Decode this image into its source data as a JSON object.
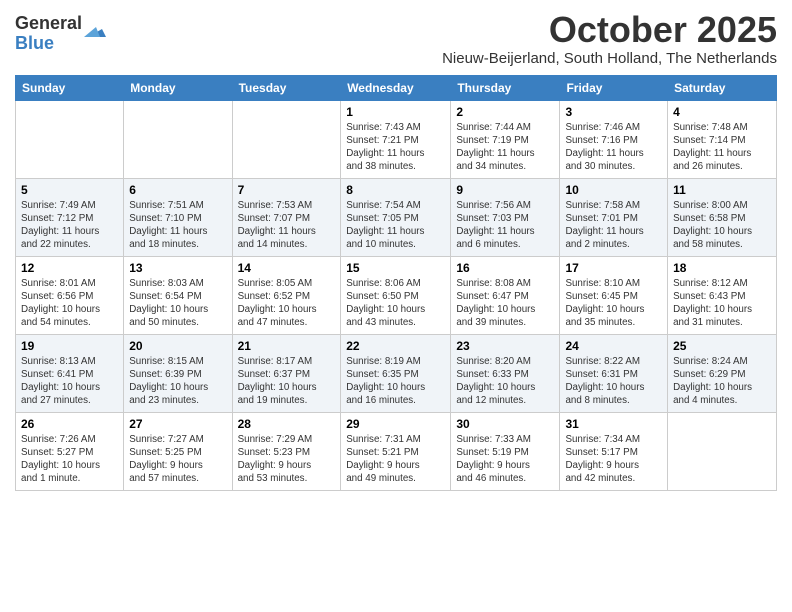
{
  "logo": {
    "general": "General",
    "blue": "Blue"
  },
  "header": {
    "month": "October 2025",
    "location": "Nieuw-Beijerland, South Holland, The Netherlands"
  },
  "days_of_week": [
    "Sunday",
    "Monday",
    "Tuesday",
    "Wednesday",
    "Thursday",
    "Friday",
    "Saturday"
  ],
  "weeks": [
    [
      {
        "day": "",
        "info": ""
      },
      {
        "day": "",
        "info": ""
      },
      {
        "day": "",
        "info": ""
      },
      {
        "day": "1",
        "info": "Sunrise: 7:43 AM\nSunset: 7:21 PM\nDaylight: 11 hours\nand 38 minutes."
      },
      {
        "day": "2",
        "info": "Sunrise: 7:44 AM\nSunset: 7:19 PM\nDaylight: 11 hours\nand 34 minutes."
      },
      {
        "day": "3",
        "info": "Sunrise: 7:46 AM\nSunset: 7:16 PM\nDaylight: 11 hours\nand 30 minutes."
      },
      {
        "day": "4",
        "info": "Sunrise: 7:48 AM\nSunset: 7:14 PM\nDaylight: 11 hours\nand 26 minutes."
      }
    ],
    [
      {
        "day": "5",
        "info": "Sunrise: 7:49 AM\nSunset: 7:12 PM\nDaylight: 11 hours\nand 22 minutes."
      },
      {
        "day": "6",
        "info": "Sunrise: 7:51 AM\nSunset: 7:10 PM\nDaylight: 11 hours\nand 18 minutes."
      },
      {
        "day": "7",
        "info": "Sunrise: 7:53 AM\nSunset: 7:07 PM\nDaylight: 11 hours\nand 14 minutes."
      },
      {
        "day": "8",
        "info": "Sunrise: 7:54 AM\nSunset: 7:05 PM\nDaylight: 11 hours\nand 10 minutes."
      },
      {
        "day": "9",
        "info": "Sunrise: 7:56 AM\nSunset: 7:03 PM\nDaylight: 11 hours\nand 6 minutes."
      },
      {
        "day": "10",
        "info": "Sunrise: 7:58 AM\nSunset: 7:01 PM\nDaylight: 11 hours\nand 2 minutes."
      },
      {
        "day": "11",
        "info": "Sunrise: 8:00 AM\nSunset: 6:58 PM\nDaylight: 10 hours\nand 58 minutes."
      }
    ],
    [
      {
        "day": "12",
        "info": "Sunrise: 8:01 AM\nSunset: 6:56 PM\nDaylight: 10 hours\nand 54 minutes."
      },
      {
        "day": "13",
        "info": "Sunrise: 8:03 AM\nSunset: 6:54 PM\nDaylight: 10 hours\nand 50 minutes."
      },
      {
        "day": "14",
        "info": "Sunrise: 8:05 AM\nSunset: 6:52 PM\nDaylight: 10 hours\nand 47 minutes."
      },
      {
        "day": "15",
        "info": "Sunrise: 8:06 AM\nSunset: 6:50 PM\nDaylight: 10 hours\nand 43 minutes."
      },
      {
        "day": "16",
        "info": "Sunrise: 8:08 AM\nSunset: 6:47 PM\nDaylight: 10 hours\nand 39 minutes."
      },
      {
        "day": "17",
        "info": "Sunrise: 8:10 AM\nSunset: 6:45 PM\nDaylight: 10 hours\nand 35 minutes."
      },
      {
        "day": "18",
        "info": "Sunrise: 8:12 AM\nSunset: 6:43 PM\nDaylight: 10 hours\nand 31 minutes."
      }
    ],
    [
      {
        "day": "19",
        "info": "Sunrise: 8:13 AM\nSunset: 6:41 PM\nDaylight: 10 hours\nand 27 minutes."
      },
      {
        "day": "20",
        "info": "Sunrise: 8:15 AM\nSunset: 6:39 PM\nDaylight: 10 hours\nand 23 minutes."
      },
      {
        "day": "21",
        "info": "Sunrise: 8:17 AM\nSunset: 6:37 PM\nDaylight: 10 hours\nand 19 minutes."
      },
      {
        "day": "22",
        "info": "Sunrise: 8:19 AM\nSunset: 6:35 PM\nDaylight: 10 hours\nand 16 minutes."
      },
      {
        "day": "23",
        "info": "Sunrise: 8:20 AM\nSunset: 6:33 PM\nDaylight: 10 hours\nand 12 minutes."
      },
      {
        "day": "24",
        "info": "Sunrise: 8:22 AM\nSunset: 6:31 PM\nDaylight: 10 hours\nand 8 minutes."
      },
      {
        "day": "25",
        "info": "Sunrise: 8:24 AM\nSunset: 6:29 PM\nDaylight: 10 hours\nand 4 minutes."
      }
    ],
    [
      {
        "day": "26",
        "info": "Sunrise: 7:26 AM\nSunset: 5:27 PM\nDaylight: 10 hours\nand 1 minute."
      },
      {
        "day": "27",
        "info": "Sunrise: 7:27 AM\nSunset: 5:25 PM\nDaylight: 9 hours\nand 57 minutes."
      },
      {
        "day": "28",
        "info": "Sunrise: 7:29 AM\nSunset: 5:23 PM\nDaylight: 9 hours\nand 53 minutes."
      },
      {
        "day": "29",
        "info": "Sunrise: 7:31 AM\nSunset: 5:21 PM\nDaylight: 9 hours\nand 49 minutes."
      },
      {
        "day": "30",
        "info": "Sunrise: 7:33 AM\nSunset: 5:19 PM\nDaylight: 9 hours\nand 46 minutes."
      },
      {
        "day": "31",
        "info": "Sunrise: 7:34 AM\nSunset: 5:17 PM\nDaylight: 9 hours\nand 42 minutes."
      },
      {
        "day": "",
        "info": ""
      }
    ]
  ]
}
